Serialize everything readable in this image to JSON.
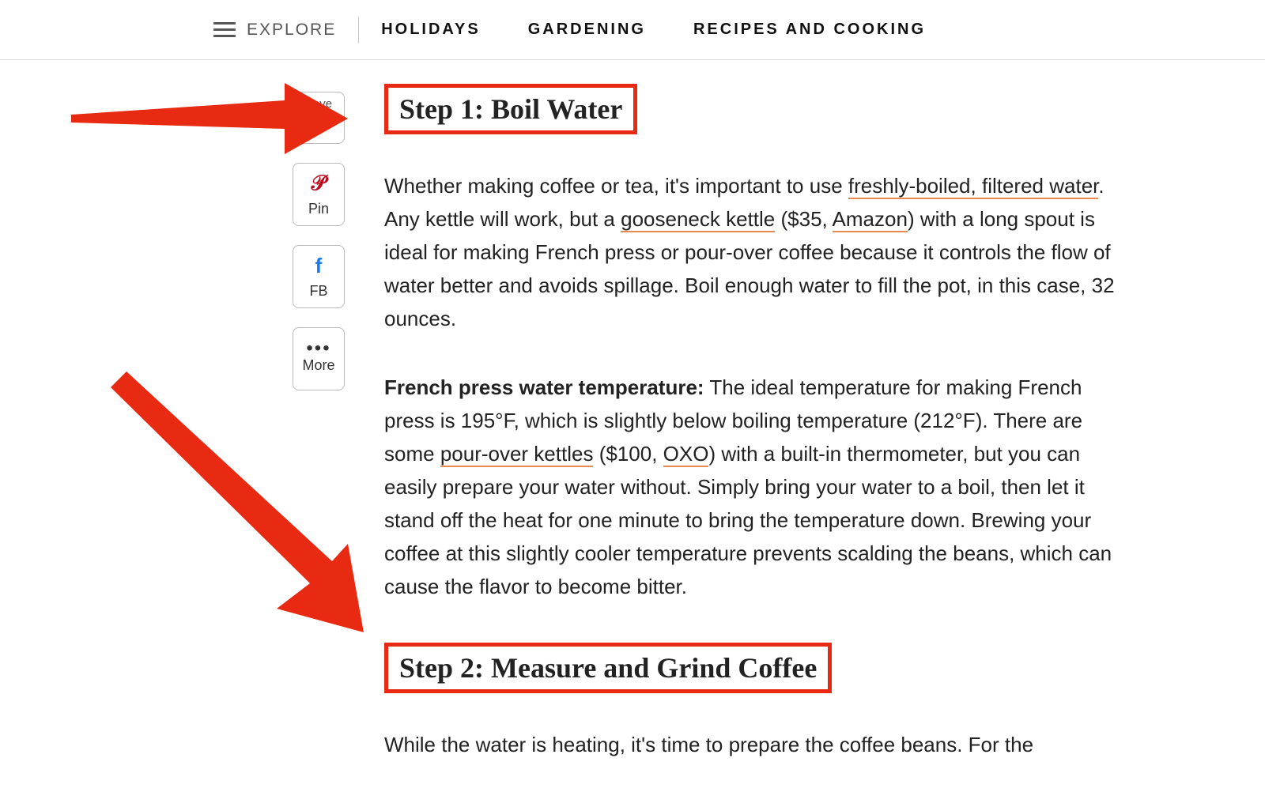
{
  "nav": {
    "explore": "EXPLORE",
    "links": [
      "HOLIDAYS",
      "GARDENING",
      "RECIPES AND COOKING"
    ]
  },
  "share": {
    "save": "Save",
    "pin": "Pin",
    "fb": "FB",
    "more": "More"
  },
  "article": {
    "step1_heading": "Step 1: Boil Water",
    "p1_a": "Whether making coffee or tea, it's important to use ",
    "p1_link1": "freshly-boiled, filtered water",
    "p1_b": ". Any kettle will work, but a ",
    "p1_link2": "gooseneck kettle",
    "p1_c": " ($35, ",
    "p1_link3": "Amazon",
    "p1_d": ") with a long spout is ideal for making French press or pour-over coffee because it controls the flow of water better and avoids spillage. Boil enough water to fill the pot, in this case, 32 ounces.",
    "p2_bold": "French press water temperature:",
    "p2_a": " The ideal temperature for making French press is 195°F, which is slightly below boiling temperature (212°F). There are some ",
    "p2_link1": "pour-over kettles",
    "p2_b": " ($100, ",
    "p2_link2": "OXO",
    "p2_c": ") with a built-in thermometer, but you can easily prepare your water without. Simply bring your water to a boil, then let it stand off the heat for one minute to bring the temperature down. Brewing your coffee at this slightly cooler temperature prevents scalding the beans, which can cause the flavor to become bitter.",
    "step2_heading": "Step 2: Measure and Grind Coffee",
    "p3": "While the water is heating, it's time to prepare the coffee beans. For the"
  }
}
